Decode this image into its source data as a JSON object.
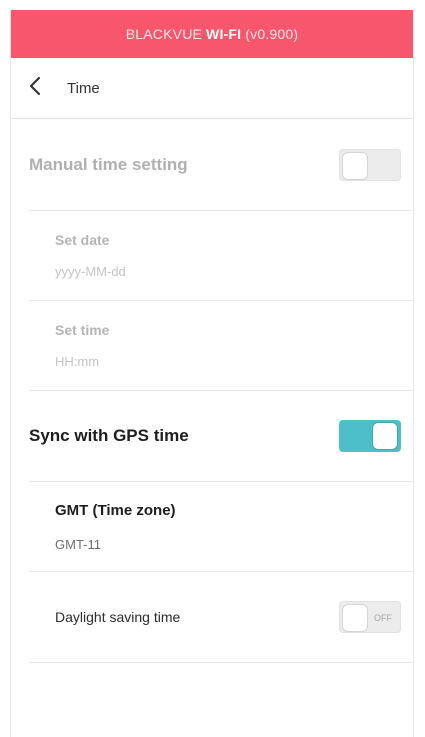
{
  "header": {
    "prefix": "BLACKVUE",
    "brand": "WI-FI",
    "version": "(v0.900)",
    "color": "#f7566c"
  },
  "nav": {
    "back_icon": "chevron-left-icon",
    "title": "Time"
  },
  "settings": {
    "manual": {
      "label": "Manual time setting",
      "toggle": "off",
      "enabled": false
    },
    "set_date": {
      "label": "Set date",
      "placeholder": "yyyy-MM-dd"
    },
    "set_time": {
      "label": "Set time",
      "placeholder": "HH:mm"
    },
    "gps": {
      "label": "Sync with GPS time",
      "toggle": "on",
      "toggle_color": "#4dbfca"
    },
    "gmt": {
      "label": "GMT (Time zone)",
      "value": "GMT-11"
    },
    "dst": {
      "label": "Daylight saving time",
      "toggle": "off",
      "toggle_text": "OFF"
    }
  }
}
